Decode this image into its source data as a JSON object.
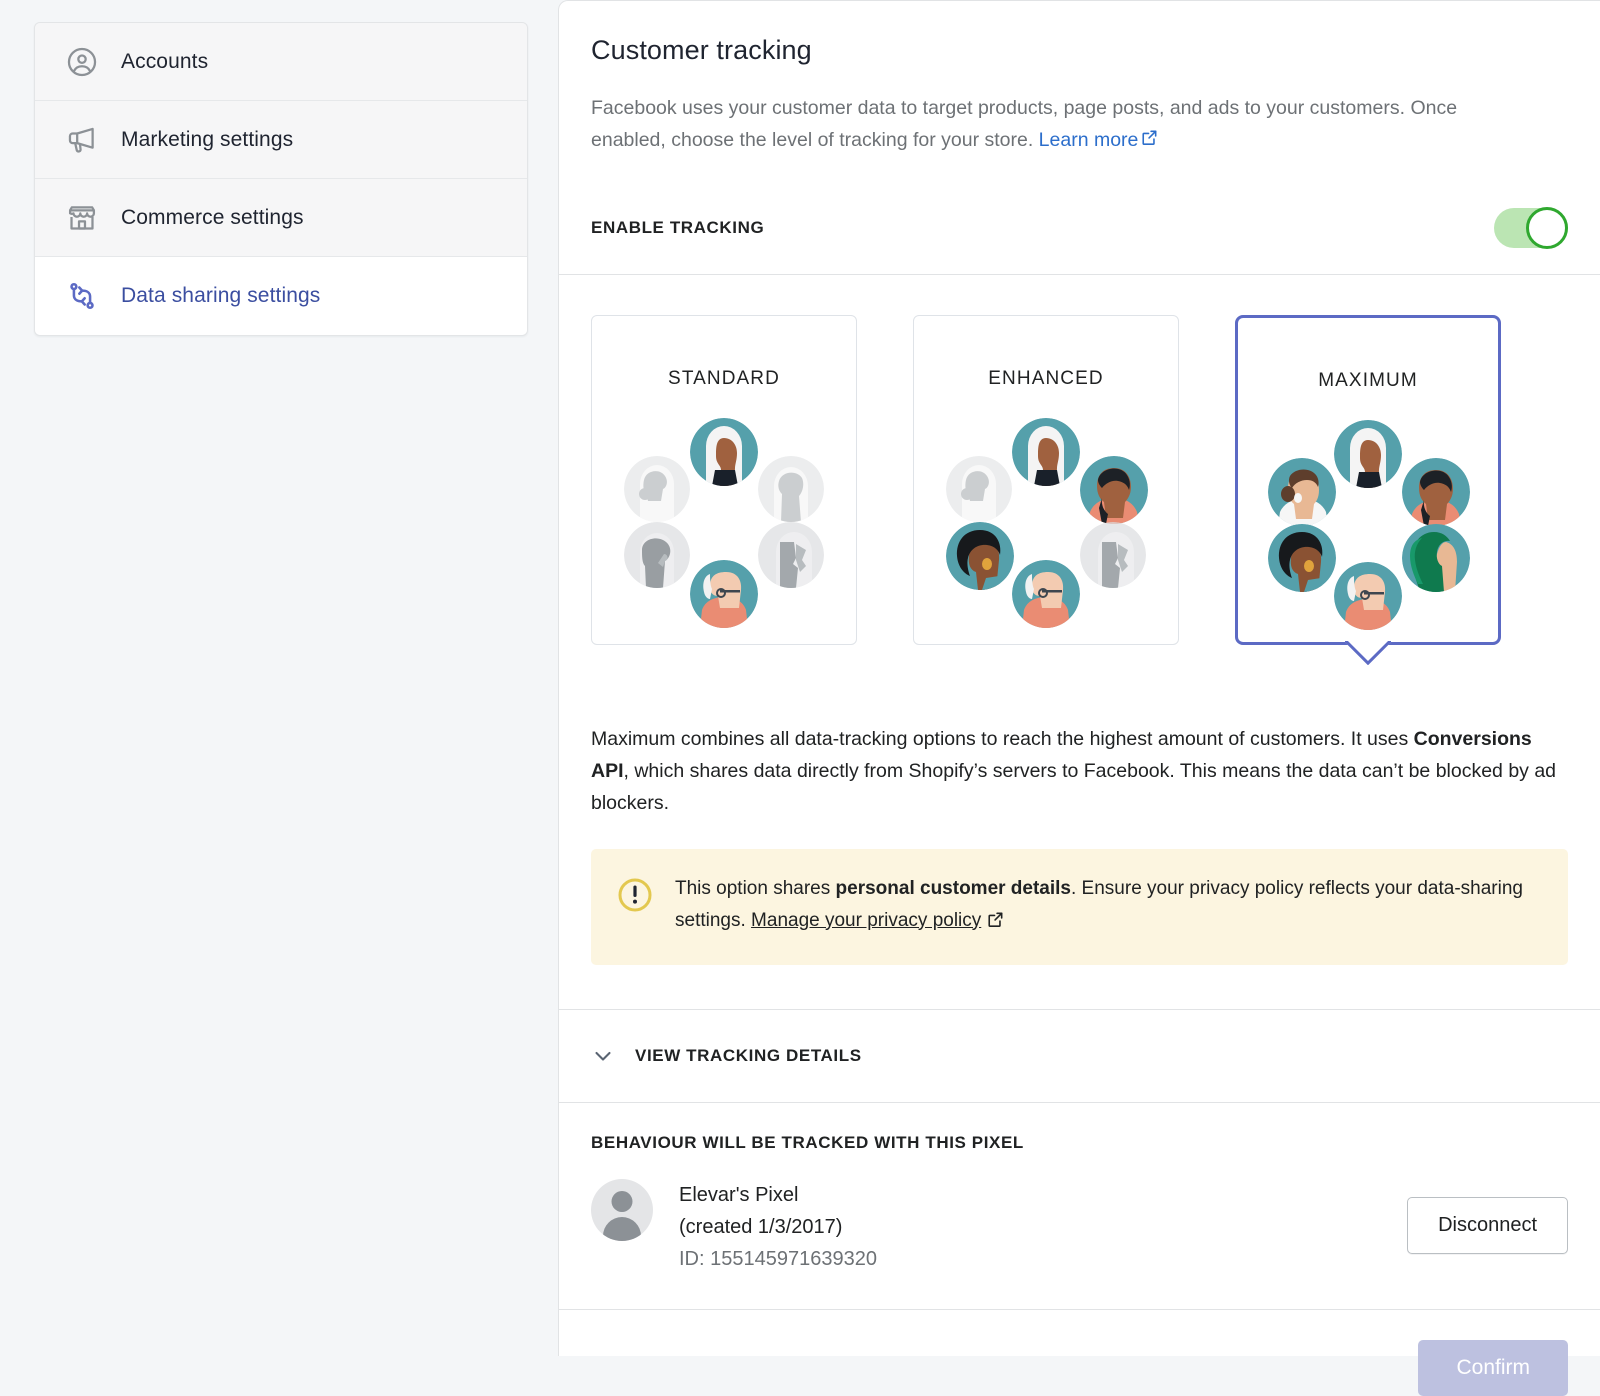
{
  "sidebar": {
    "items": [
      {
        "label": "Accounts",
        "icon": "account-circle-icon",
        "active": false
      },
      {
        "label": "Marketing settings",
        "icon": "megaphone-icon",
        "active": false
      },
      {
        "label": "Commerce settings",
        "icon": "storefront-icon",
        "active": false
      },
      {
        "label": "Data sharing settings",
        "icon": "data-sharing-icon",
        "active": true
      }
    ]
  },
  "main": {
    "title": "Customer tracking",
    "description_before_link": "Facebook uses your customer data to target products, page posts, and ads to your customers. Once enabled, choose the level of tracking for your store. ",
    "learn_more_label": "Learn more",
    "external_link_glyph": "↗",
    "enable_tracking_label": "ENABLE TRACKING",
    "toggle_state": "on",
    "toggle_on_color": "#2fa82f"
  },
  "options": {
    "cards": [
      {
        "label": "STANDARD",
        "selected": false
      },
      {
        "label": "ENHANCED",
        "selected": false
      },
      {
        "label": "MAXIMUM",
        "selected": true
      }
    ],
    "selected_accent": "#5c6ac4"
  },
  "option_description": {
    "part1": "Maximum combines all data-tracking options to reach the highest amount of customers. It uses ",
    "bold": "Conversions API",
    "part2": ", which shares data directly from Shopify’s servers to Facebook. This means the data can’t be blocked by ad blockers."
  },
  "banner": {
    "icon": "alert-circle-icon",
    "background": "#fcf5e0",
    "part1": "This option shares ",
    "bold": "personal customer details",
    "part2": ". Ensure your privacy policy reflects your data-sharing settings. ",
    "link_label": "Manage your privacy policy",
    "external_link_glyph": "↗"
  },
  "tracking_details": {
    "label": "VIEW TRACKING DETAILS",
    "icon": "chevron-down-icon",
    "expanded": false
  },
  "pixel": {
    "heading": "BEHAVIOUR WILL BE TRACKED WITH THIS PIXEL",
    "name": "Elevar's Pixel",
    "created": "(created 1/3/2017)",
    "id": "ID: 155145971639320",
    "disconnect_label": "Disconnect"
  },
  "footer": {
    "confirm_label": "Confirm",
    "confirm_disabled": true
  }
}
